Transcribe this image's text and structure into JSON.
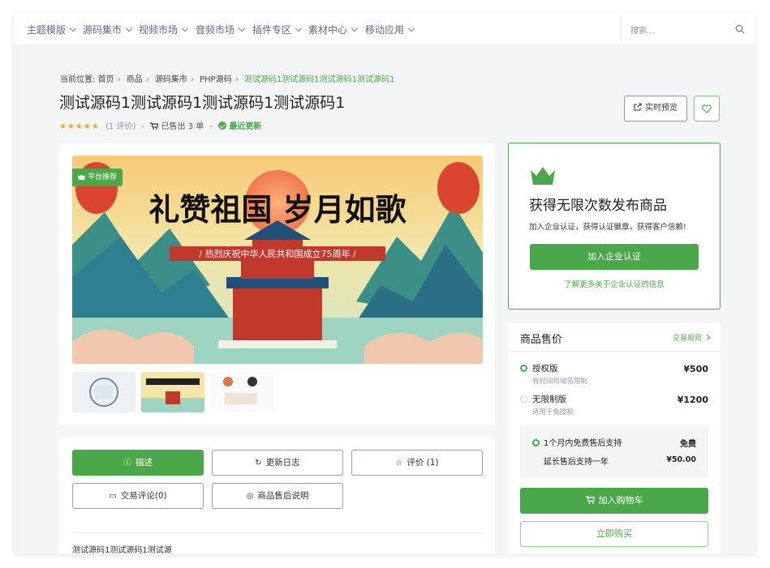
{
  "nav": {
    "items": [
      "主题模版",
      "源码集市",
      "视频市场",
      "音频市场",
      "插件专区",
      "素材中心",
      "移动应用"
    ],
    "search_placeholder": "搜索..."
  },
  "breadcrumb": {
    "prefix": "当前位置:",
    "items": [
      "首页",
      "商品",
      "源码集市",
      "PHP源码"
    ],
    "current": "测试源码1测试源码1测试源码1测试源码1"
  },
  "product": {
    "title": "测试源码1测试源码1测试源码1测试源码1",
    "stars": "★★★★★",
    "rating_count": "(1 评价)",
    "sold": "已售出 3 单",
    "updated": "最近更新",
    "preview_label": "实时预览",
    "recommend_tag": "平台推荐",
    "banner_title": "礼赞祖国  岁月如歌",
    "banner_subtitle": "/ 热烈庆祝中华人民共和国成立75周年 /"
  },
  "promo": {
    "title": "获得无限次数发布商品",
    "desc": "加入企业认证，获得认证徽章，获得客户信赖!",
    "join_label": "加入企业认证",
    "more_label": "了解更多关于企业认证的信息"
  },
  "pricing": {
    "header": "商品售价",
    "rule_label": "交易规则",
    "options": [
      {
        "name": "授权版",
        "sub": "有时间和域名限制",
        "price": "¥500",
        "selected": true
      },
      {
        "name": "无限制版",
        "sub": "适用于免授权",
        "price": "¥1200",
        "selected": false
      }
    ],
    "support": {
      "free_label": "1个月内免费售后支持",
      "free_value": "免费",
      "extend_label": "延长售后支持一年",
      "extend_value": "¥50.00"
    },
    "cart_label": "加入购物车",
    "buy_label": "立即购买"
  },
  "tabs": {
    "items": [
      "描述",
      "更新日志",
      "评价 (1)",
      "交易评论(0)",
      "商品售后说明"
    ],
    "active": 0,
    "body_text": "测试源码1测试源码1测试源"
  },
  "colors": {
    "accent": "#4aa84a",
    "star": "#f5a623"
  }
}
